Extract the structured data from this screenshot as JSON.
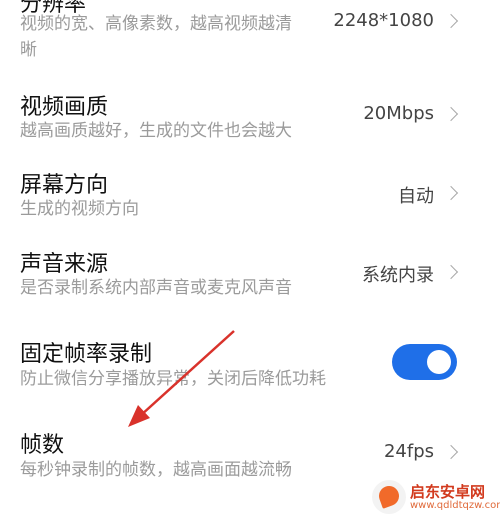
{
  "settings": [
    {
      "title": "分辨率",
      "desc_lines": [
        "视频的宽、高像素数，越高视频越清",
        "晰"
      ],
      "value": "2248*1080"
    },
    {
      "title": "视频画质",
      "desc_lines": [
        "越高画质越好，生成的文件也会越大"
      ],
      "value": "20Mbps"
    },
    {
      "title": "屏幕方向",
      "desc_lines": [
        "生成的视频方向"
      ],
      "value": "自动"
    },
    {
      "title": "声音来源",
      "desc_lines": [
        "是否录制系统内部声音或麦克风声音"
      ],
      "value": "系统内录"
    },
    {
      "title": "固定帧率录制",
      "desc_lines": [
        "防止微信分享播放异常，关闭后降低功耗"
      ],
      "toggle_on": true
    },
    {
      "title": "帧数",
      "desc_lines": [
        "每秒钟录制的帧数，越高画面越流畅"
      ],
      "value": "24fps"
    }
  ],
  "colors": {
    "toggle": "#1f6fe8",
    "arrow": "#d9322b"
  },
  "watermark": {
    "brand": "启东安卓网",
    "url": "www.qdldtqzw.com"
  }
}
